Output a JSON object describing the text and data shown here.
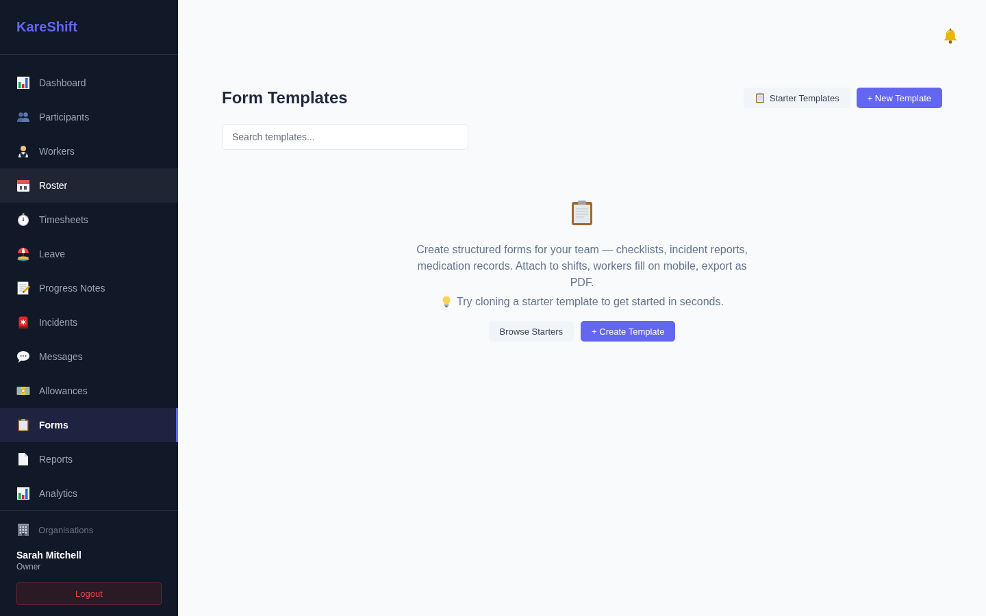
{
  "sidebar": {
    "brand": "KareShift",
    "nav_items": [
      {
        "label": "Dashboard",
        "selected": false,
        "hovered": false
      },
      {
        "label": "Participants",
        "selected": false,
        "hovered": false
      },
      {
        "label": "Workers",
        "selected": false,
        "hovered": false
      },
      {
        "label": "Roster",
        "selected": false,
        "hovered": true
      },
      {
        "label": "Timesheets",
        "selected": false,
        "hovered": false
      },
      {
        "label": "Leave",
        "selected": false,
        "hovered": false
      },
      {
        "label": "Progress Notes",
        "selected": false,
        "hovered": false
      },
      {
        "label": "Incidents",
        "selected": false,
        "hovered": false
      },
      {
        "label": "Messages",
        "selected": false,
        "hovered": false
      },
      {
        "label": "Allowances",
        "selected": false,
        "hovered": false
      },
      {
        "label": "Forms",
        "selected": true,
        "hovered": false
      },
      {
        "label": "Reports",
        "selected": false,
        "hovered": false
      },
      {
        "label": "Analytics",
        "selected": false,
        "hovered": false
      }
    ],
    "organisations_link": "Organisations",
    "user": {
      "name": "Sarah Mitchell",
      "role": "Owner"
    },
    "logout_button": "Logout"
  },
  "header": {
    "title": "Form Templates",
    "buttons": [
      {
        "label": "Starter Templates",
        "kind": "secondary"
      },
      {
        "label": "+ New Template",
        "kind": "primary"
      }
    ]
  },
  "search": {
    "placeholder": "Search templates..."
  },
  "empty_state": {
    "description": "Create structured forms for your team — checklists, incident reports, medication records. Attach to shifts, workers fill on mobile, export as PDF.",
    "tip": "Try cloning a starter template to get started in seconds.",
    "buttons": [
      {
        "label": "Browse Starters",
        "kind": "secondary"
      },
      {
        "label": "+ Create Template",
        "kind": "primary"
      }
    ]
  }
}
